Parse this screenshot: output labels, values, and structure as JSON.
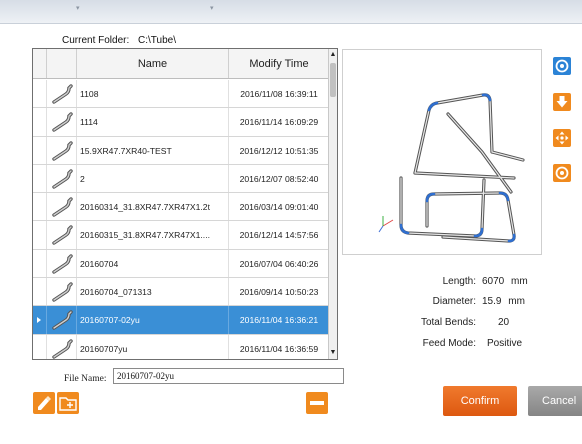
{
  "folder": {
    "label": "Current Folder:",
    "path": "C:\\Tube\\"
  },
  "table": {
    "headers": {
      "name": "Name",
      "time": "Modify Time"
    },
    "rows": [
      {
        "name": "1108",
        "time": "2016/11/08 16:39:11"
      },
      {
        "name": "1114",
        "time": "2016/11/14 16:09:29"
      },
      {
        "name": "15.9XR47.7XR40-TEST",
        "time": "2016/12/12 10:51:35"
      },
      {
        "name": "2",
        "time": "2016/12/07 08:52:40"
      },
      {
        "name": "20160314_31.8XR47.7XR47X1.2t",
        "time": "2016/03/14 09:01:40"
      },
      {
        "name": "20160315_31.8XR47.7XR47X1....",
        "time": "2016/12/14 14:57:56"
      },
      {
        "name": "20160704",
        "time": "2016/07/04 06:40:26"
      },
      {
        "name": "20160704_071313",
        "time": "2016/09/14 10:50:23"
      },
      {
        "name": "20160707-02yu",
        "time": "2016/11/04 16:36:21",
        "selected": true
      },
      {
        "name": "20160707yu",
        "time": "2016/11/04 16:36:59"
      }
    ]
  },
  "file_name": {
    "label": "File Name:",
    "value": "20160707-02yu"
  },
  "properties": {
    "length": {
      "label": "Length:",
      "value": "6070",
      "unit": "mm"
    },
    "diameter": {
      "label": "Diameter:",
      "value": "15.9",
      "unit": "mm"
    },
    "bends": {
      "label": "Total Bends:",
      "value": "20"
    },
    "feed": {
      "label": "Feed Mode:",
      "value": "Positive"
    }
  },
  "buttons": {
    "confirm": "Confirm",
    "cancel": "Cancel"
  },
  "icons": {
    "view_reset": "target-circle-icon",
    "view_down": "arrow-down-icon",
    "view_pan": "move-arrows-icon",
    "view_center": "ring-icon",
    "edit": "pencil-eraser-icon",
    "new_folder": "folder-add-icon",
    "delete": "minus-icon"
  },
  "colors": {
    "accent_blue": "#3a8fd6",
    "accent_orange": "#f07a2e",
    "gray": "#999999"
  }
}
